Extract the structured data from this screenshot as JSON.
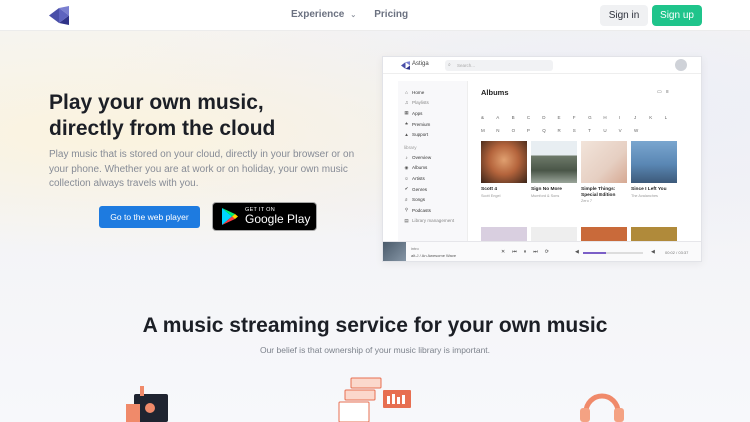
{
  "nav": {
    "links": [
      {
        "label": "Experience",
        "has_dropdown": true
      },
      {
        "label": "Pricing",
        "has_dropdown": false
      }
    ],
    "signin_label": "Sign in",
    "signup_label": "Sign up",
    "colors": {
      "signup": "#1fc48b",
      "logo": "#4a4fa8"
    }
  },
  "hero": {
    "title_line1": "Play your own music,",
    "title_line2": "directly from the cloud",
    "description": "Play music that is stored on your cloud, directly in your browser or on your phone. Whether you are at work or on holiday, your own music collection always travels with you.",
    "cta_label": "Go to the web player",
    "gplay_small": "GET IT ON",
    "gplay_big": "Google Play"
  },
  "app": {
    "name": "Astiga",
    "search_placeholder": "Search...",
    "sidebar": {
      "top_items": [
        {
          "icon": "home-icon",
          "label": "Home"
        },
        {
          "icon": "playlist-icon",
          "label": "Playlists"
        },
        {
          "icon": "apps-icon",
          "label": "Apps"
        },
        {
          "icon": "star-icon",
          "label": "Premium"
        },
        {
          "icon": "support-icon",
          "label": "Support"
        }
      ],
      "library_heading": "library",
      "library_items": [
        {
          "icon": "overview-icon",
          "label": "Overview"
        },
        {
          "icon": "album-icon",
          "label": "Albums"
        },
        {
          "icon": "artist-icon",
          "label": "Artists"
        },
        {
          "icon": "genre-icon",
          "label": "Genres"
        },
        {
          "icon": "song-icon",
          "label": "Songs"
        },
        {
          "icon": "podcast-icon",
          "label": "Podcasts"
        },
        {
          "icon": "library-mgmt-icon",
          "label": "Library management"
        }
      ]
    },
    "albums_title": "Albums",
    "letters": [
      "&",
      "A",
      "B",
      "C",
      "D",
      "E",
      "F",
      "G",
      "H",
      "I",
      "J",
      "K",
      "L",
      "M",
      "N",
      "O",
      "P",
      "Q",
      "R",
      "S",
      "T",
      "U",
      "V",
      "W"
    ],
    "albums": [
      {
        "title": "Scott 4",
        "artist": "Scott Engel",
        "color": "#b4643c"
      },
      {
        "title": "Sign No More",
        "artist": "Mumford & Sons",
        "color": "#7d8a78"
      },
      {
        "title": "Simple Things: Special Edition",
        "artist": "Zero 7",
        "color": "#e8d4c8"
      },
      {
        "title": "Since I Left You",
        "artist": "The Avalanches",
        "color": "#5a87b4"
      }
    ],
    "player": {
      "track_label": "intro",
      "track_sub": "alt-J / An Awesome Wave",
      "time": "00:02 / 03:37",
      "progress": 0.38
    }
  },
  "section2": {
    "title": "A music streaming service for your own music",
    "subtitle": "Our belief is that ownership of your music library is important."
  }
}
